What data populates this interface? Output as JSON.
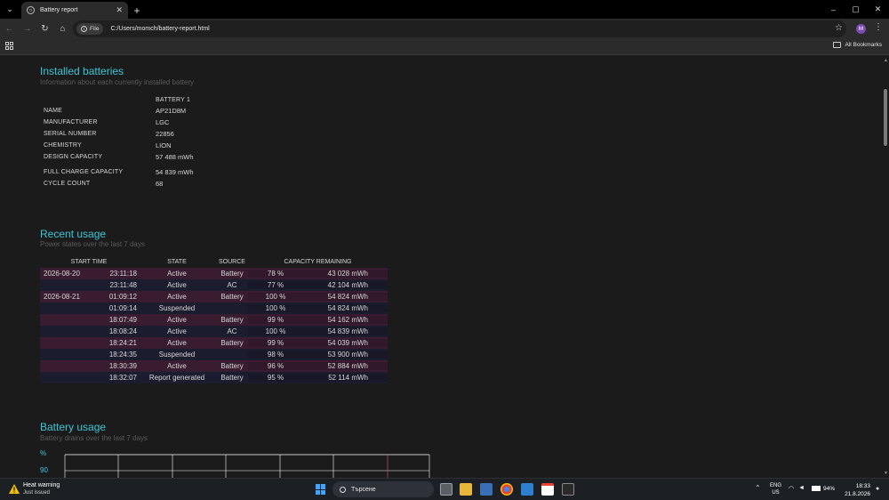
{
  "browser": {
    "tab_title": "Battery report",
    "url": "C:/Users/momch/battery-report.html",
    "file_chip": "File",
    "profile_initial": "M",
    "all_bookmarks": "All Bookmarks",
    "icons": [
      "tab-search-icon",
      "favicon-globe-icon",
      "close-icon",
      "plus-icon",
      "minimize-icon",
      "restore-icon",
      "back-icon",
      "forward-icon",
      "reload-icon",
      "home-icon",
      "info-icon",
      "star-icon",
      "kebab-icon",
      "apps-grid-icon",
      "folder-icon"
    ]
  },
  "installed": {
    "title": "Installed batteries",
    "subtitle": "Information about each currently installed battery",
    "column_header": "BATTERY 1",
    "rows": [
      {
        "label": "NAME",
        "value": "AP21D8M"
      },
      {
        "label": "MANUFACTURER",
        "value": "LGC"
      },
      {
        "label": "SERIAL NUMBER",
        "value": "22856"
      },
      {
        "label": "CHEMISTRY",
        "value": "LION"
      },
      {
        "label": "DESIGN CAPACITY",
        "value": "57 488 mWh"
      },
      {
        "label": "FULL CHARGE CAPACITY",
        "value": "54 839 mWh"
      },
      {
        "label": "CYCLE COUNT",
        "value": "68"
      }
    ]
  },
  "recent": {
    "title": "Recent usage",
    "subtitle": "Power states over the last 7 days",
    "headers": {
      "start_time": "START TIME",
      "state": "STATE",
      "source": "SOURCE",
      "capacity": "CAPACITY REMAINING"
    },
    "rows": [
      {
        "date": "2026-08-20",
        "time": "23:11:18",
        "state": "Active",
        "source": "Battery",
        "pct": "78 %",
        "mwh": "43 028 mWh"
      },
      {
        "date": "",
        "time": "23:11:48",
        "state": "Active",
        "source": "AC",
        "pct": "77 %",
        "mwh": "42 104 mWh"
      },
      {
        "date": "2026-08-21",
        "time": "01:09:12",
        "state": "Active",
        "source": "Battery",
        "pct": "100 %",
        "mwh": "54 824 mWh"
      },
      {
        "date": "",
        "time": "01:09:14",
        "state": "Suspended",
        "source": "",
        "pct": "100 %",
        "mwh": "54 824 mWh"
      },
      {
        "date": "",
        "time": "18:07:49",
        "state": "Active",
        "source": "Battery",
        "pct": "99 %",
        "mwh": "54 162 mWh"
      },
      {
        "date": "",
        "time": "18:08:24",
        "state": "Active",
        "source": "AC",
        "pct": "100 %",
        "mwh": "54 839 mWh"
      },
      {
        "date": "",
        "time": "18:24:21",
        "state": "Active",
        "source": "Battery",
        "pct": "99 %",
        "mwh": "54 039 mWh"
      },
      {
        "date": "",
        "time": "18:24:35",
        "state": "Suspended",
        "source": "",
        "pct": "98 %",
        "mwh": "53 900 mWh"
      },
      {
        "date": "",
        "time": "18:30:39",
        "state": "Active",
        "source": "Battery",
        "pct": "96 %",
        "mwh": "52 884 mWh"
      },
      {
        "date": "",
        "time": "18:32:07",
        "state": "Report generated",
        "source": "Battery",
        "pct": "95 %",
        "mwh": "52 114 mWh"
      }
    ]
  },
  "battery_usage": {
    "title": "Battery usage",
    "subtitle": "Battery drains over the last 7 days",
    "y_unit": "%",
    "y_tick": "90"
  },
  "taskbar": {
    "warning_title": "Heat warning",
    "warning_sub": "Just issued",
    "search_placeholder": "Търсене",
    "lang_line1": "ENG",
    "lang_line2": "US",
    "battery_pct": "94%",
    "time": "18:33",
    "date": "21.8.2026 г.",
    "battery_level": 0.94
  },
  "colors": {
    "accent": "#3cc6d6",
    "row_odd": "#3a1c31",
    "row_even": "#1c1c2f",
    "start_blue": "#3fa6ff",
    "warning": "#f2c200"
  }
}
